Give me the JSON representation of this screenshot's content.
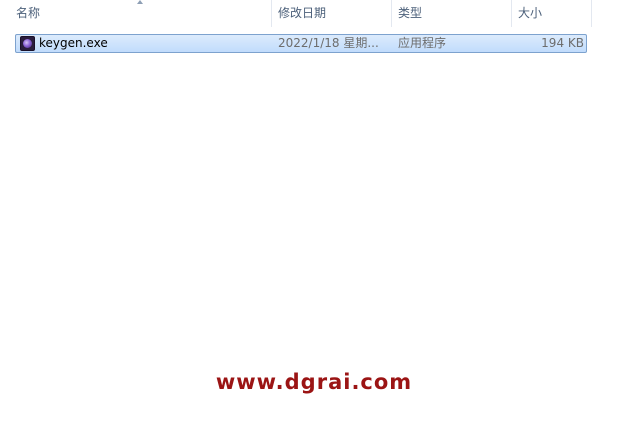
{
  "columns": {
    "name": "名称",
    "date_modified": "修改日期",
    "type": "类型",
    "size": "大小"
  },
  "files": [
    {
      "name": "keygen.exe",
      "date_modified": "2022/1/18 星期...",
      "type": "应用程序",
      "size": "194 KB",
      "icon": "application-exe-icon",
      "selected": true
    }
  ],
  "watermark": "www.dgrai.com",
  "colors": {
    "selection_fill": "#c9e0fc",
    "selection_border": "#7da2ce",
    "header_text": "#4c607a",
    "watermark": "#9b1414"
  }
}
